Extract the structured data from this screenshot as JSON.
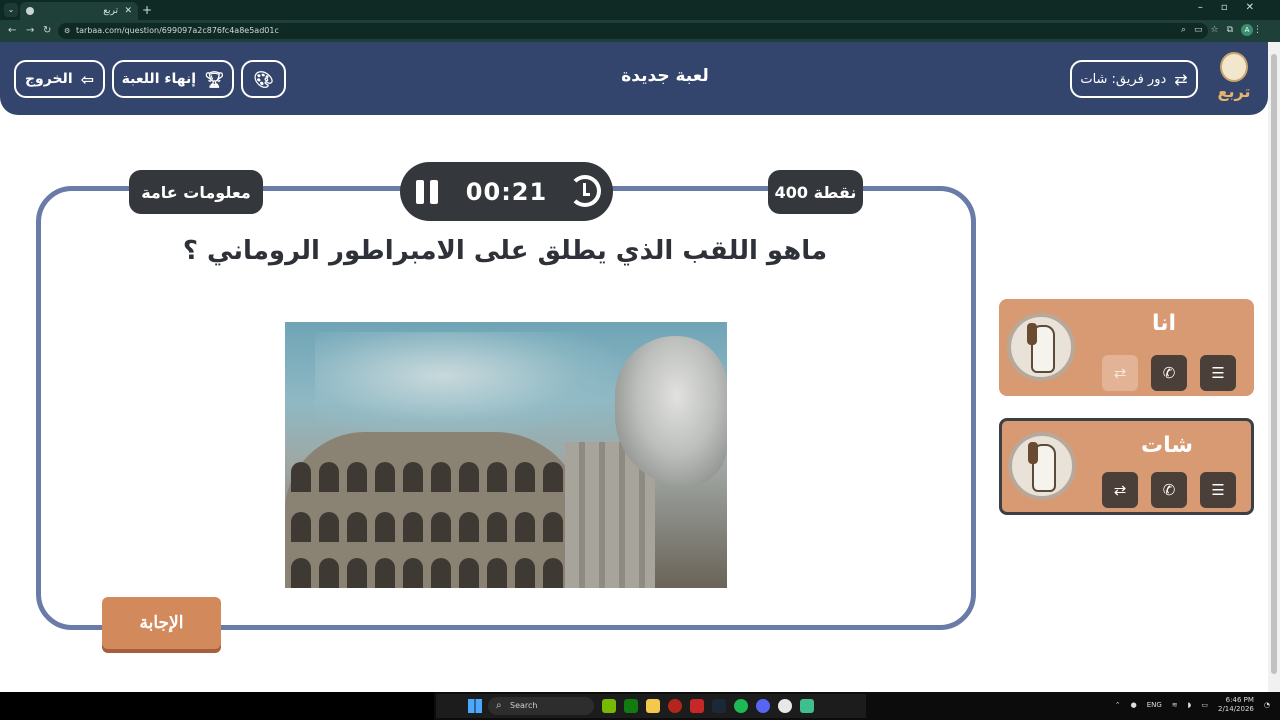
{
  "browser": {
    "tab_title": "تربع",
    "url": "tarbaa.com/question/699097a2c876fc4a8e5ad01c",
    "profile_initial": "A"
  },
  "header": {
    "title": "لعبة جديدة",
    "turn_button": "دور فريق: شات",
    "end_game_button": "إنهاء اللعبة",
    "exit_button": "الخروج",
    "logo_text": "تربع"
  },
  "question": {
    "category": "معلومات عامة",
    "points": "400 نقطة",
    "timer": "00:21",
    "text": "ماهو اللقب الذي يطلق على الامبراطور الروماني ؟",
    "answer_button": "الإجابة"
  },
  "teams": [
    {
      "name": "انا",
      "active": false
    },
    {
      "name": "شات",
      "active": true
    }
  ],
  "taskbar": {
    "search_placeholder": "Search",
    "language": "ENG",
    "time": "6:46 PM",
    "date": "2/14/2026"
  },
  "colors": {
    "header_bg": "#34456d",
    "card_border": "#6b7ba8",
    "pill_bg": "#34373b",
    "team_bg": "#d89a73",
    "answer_bg": "#d28a5c"
  }
}
